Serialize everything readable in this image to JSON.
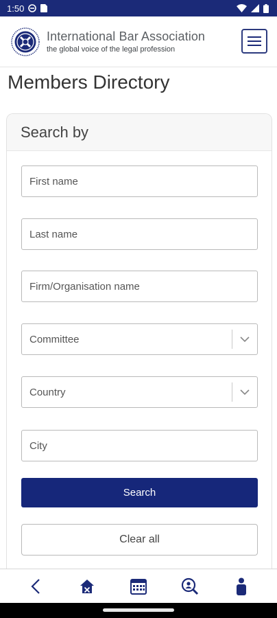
{
  "status_bar": {
    "time": "1:50",
    "icons": [
      "dnd-icon",
      "sim-card-icon",
      "wifi-icon",
      "signal-icon",
      "battery-icon"
    ]
  },
  "header": {
    "brand_name": "International Bar Association",
    "brand_tagline": "the global voice of the legal profession",
    "menu_icon": "hamburger-menu-icon"
  },
  "page": {
    "title": "Members Directory"
  },
  "search": {
    "card_title": "Search by",
    "first_name_placeholder": "First name",
    "last_name_placeholder": "Last name",
    "firm_placeholder": "Firm/Organisation name",
    "committee_label": "Committee",
    "country_label": "Country",
    "city_placeholder": "City",
    "search_label": "Search",
    "clear_label": "Clear all"
  },
  "bottom_nav": {
    "items": [
      "back-chevron-icon",
      "home-icon",
      "calendar-icon",
      "search-people-icon",
      "person-icon"
    ]
  },
  "colors": {
    "brand_navy": "#16277a",
    "status_bar": "#1b2a78"
  }
}
